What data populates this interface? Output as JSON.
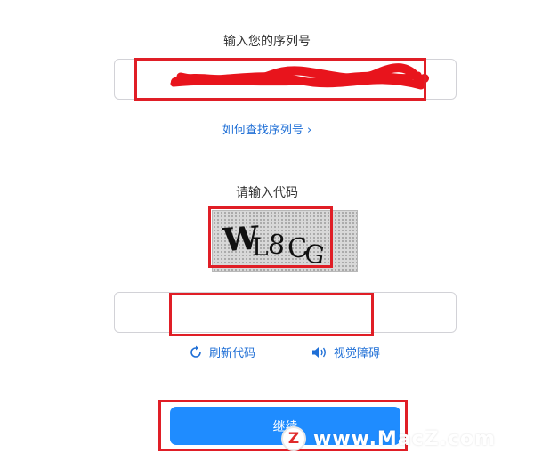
{
  "serial": {
    "title": "输入您的序列号",
    "value": "",
    "find_link": "如何查找序列号"
  },
  "captcha": {
    "title": "请输入代码",
    "image_text": "WL8CG",
    "input_value": "",
    "refresh_label": "刷新代码",
    "vision_label": "视觉障碍"
  },
  "continue_label": "继续",
  "watermark": {
    "badge": "Z",
    "text": "www.MacZ.com"
  },
  "colors": {
    "link": "#1f6fd6",
    "button": "#1f8cff",
    "annotation": "#e01e26"
  }
}
